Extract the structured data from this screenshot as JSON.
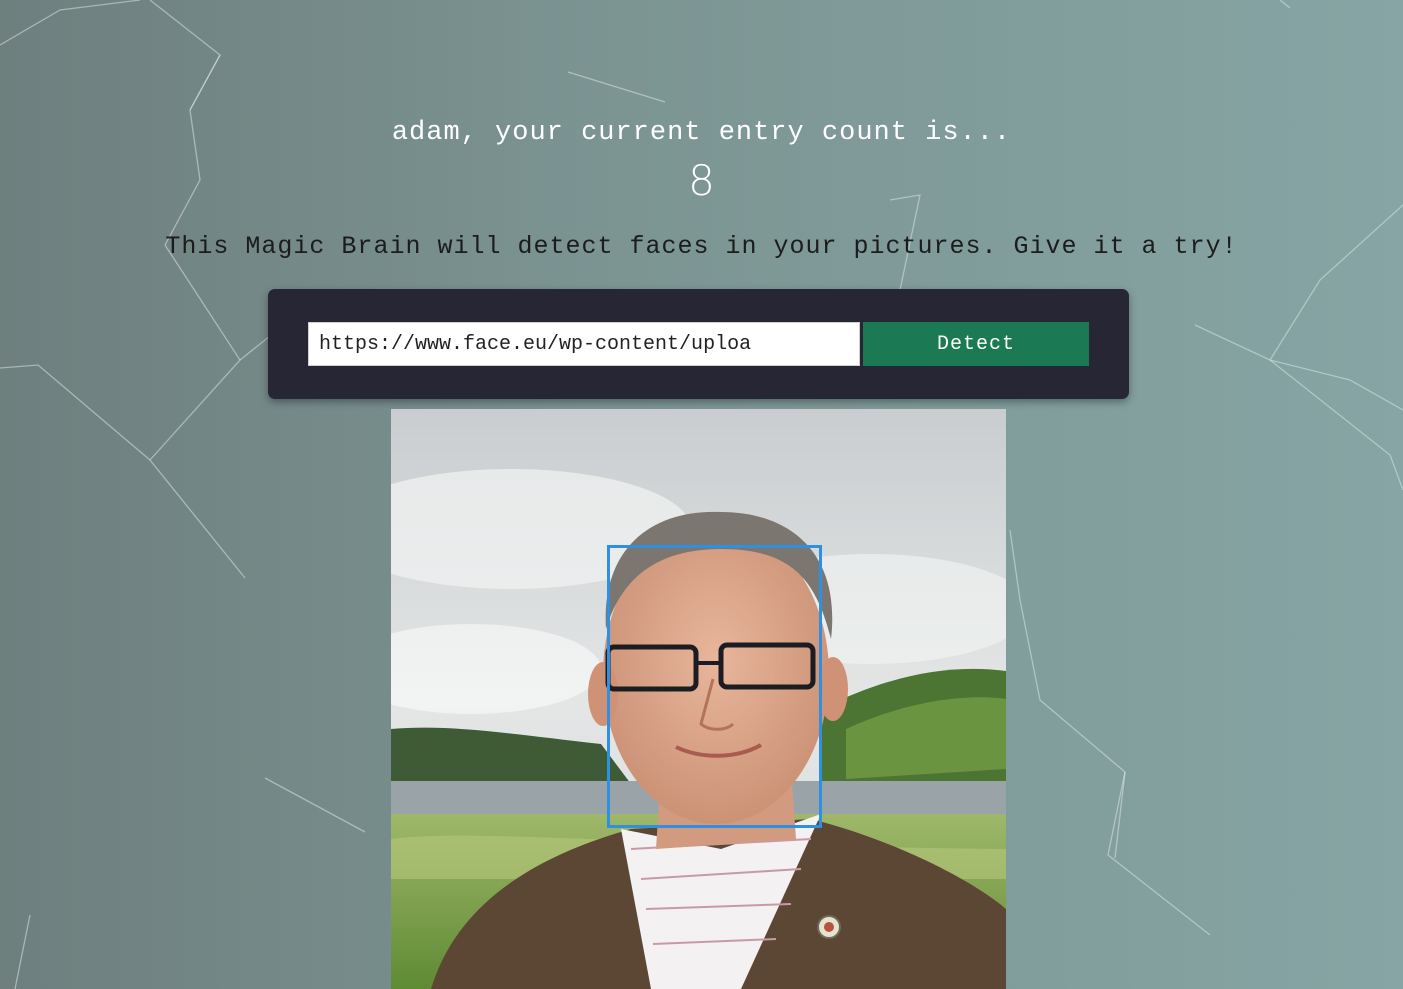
{
  "greeting": "adam, your current entry count is...",
  "entry_count": "8",
  "tagline": "This Magic Brain will detect faces in your pictures. Give it a try!",
  "form": {
    "url_value": "https://www.face.eu/wp-content/uploa",
    "detect_label": "Detect"
  },
  "colors": {
    "background": "#7c9593",
    "panel": "#272634",
    "button": "#1b7a53",
    "face_box": "#2f8fe0"
  }
}
